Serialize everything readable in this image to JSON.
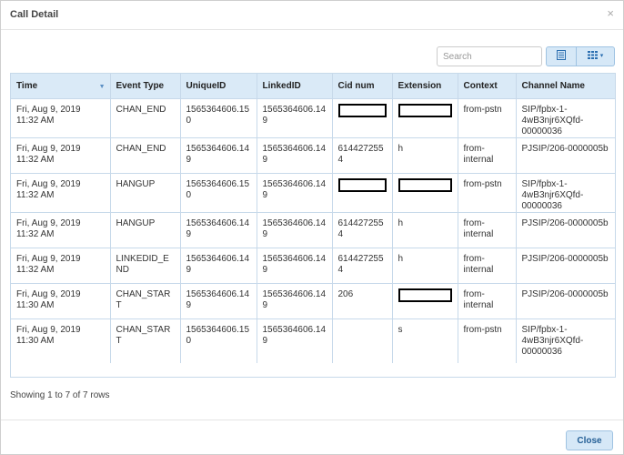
{
  "dialog": {
    "title": "Call Detail",
    "close_glyph": "×",
    "close_button_label": "Close"
  },
  "toolbar": {
    "search_placeholder": "Search",
    "list_view_icon": "list-view-icon",
    "columns_icon": "columns-grid-icon",
    "caret": "▾"
  },
  "table": {
    "columns": [
      "Time",
      "Event Type",
      "UniqueID",
      "LinkedID",
      "Cid num",
      "Extension",
      "Context",
      "Channel Name"
    ],
    "sorted_column": "Time",
    "sort_caret": "▼",
    "rows": [
      {
        "time": "Fri, Aug 9, 2019 11:32 AM",
        "event": "CHAN_END",
        "uniqueid": "1565364606.150",
        "linkedid": "1565364606.149",
        "cid": "",
        "extension": "",
        "context": "from-pstn",
        "channel": "SIP/fpbx-1-4wB3njr6XQfd-00000036",
        "cid_redacted": true,
        "ext_redacted": true
      },
      {
        "time": "Fri, Aug 9, 2019 11:32 AM",
        "event": "CHAN_END",
        "uniqueid": "1565364606.149",
        "linkedid": "1565364606.149",
        "cid": "6144272554",
        "extension": "h",
        "context": "from-internal",
        "channel": "PJSIP/206-0000005b",
        "cid_redacted": false,
        "ext_redacted": false
      },
      {
        "time": "Fri, Aug 9, 2019 11:32 AM",
        "event": "HANGUP",
        "uniqueid": "1565364606.150",
        "linkedid": "1565364606.149",
        "cid": "",
        "extension": "",
        "context": "from-pstn",
        "channel": "SIP/fpbx-1-4wB3njr6XQfd-00000036",
        "cid_redacted": true,
        "ext_redacted": true
      },
      {
        "time": "Fri, Aug 9, 2019 11:32 AM",
        "event": "HANGUP",
        "uniqueid": "1565364606.149",
        "linkedid": "1565364606.149",
        "cid": "6144272554",
        "extension": "h",
        "context": "from-internal",
        "channel": "PJSIP/206-0000005b",
        "cid_redacted": false,
        "ext_redacted": false
      },
      {
        "time": "Fri, Aug 9, 2019 11:32 AM",
        "event": "LINKEDID_END",
        "uniqueid": "1565364606.149",
        "linkedid": "1565364606.149",
        "cid": "6144272554",
        "extension": "h",
        "context": "from-internal",
        "channel": "PJSIP/206-0000005b",
        "cid_redacted": false,
        "ext_redacted": false
      },
      {
        "time": "Fri, Aug 9, 2019 11:30 AM",
        "event": "CHAN_START",
        "uniqueid": "1565364606.149",
        "linkedid": "1565364606.149",
        "cid": "206",
        "extension": "",
        "context": "from-internal",
        "channel": "PJSIP/206-0000005b",
        "cid_redacted": false,
        "ext_redacted": true
      },
      {
        "time": "Fri, Aug 9, 2019 11:30 AM",
        "event": "CHAN_START",
        "uniqueid": "1565364606.150",
        "linkedid": "1565364606.149",
        "cid": "",
        "extension": "s",
        "context": "from-pstn",
        "channel": "SIP/fpbx-1-4wB3njr6XQfd-00000036",
        "cid_redacted": false,
        "ext_redacted": false
      }
    ]
  },
  "pagination": {
    "summary": "Showing 1 to 7 of 7 rows"
  },
  "colors": {
    "header_bg": "#daeaf7",
    "border": "#c7d9ea",
    "button_bg": "#d6e8f7",
    "accent": "#245f96"
  }
}
